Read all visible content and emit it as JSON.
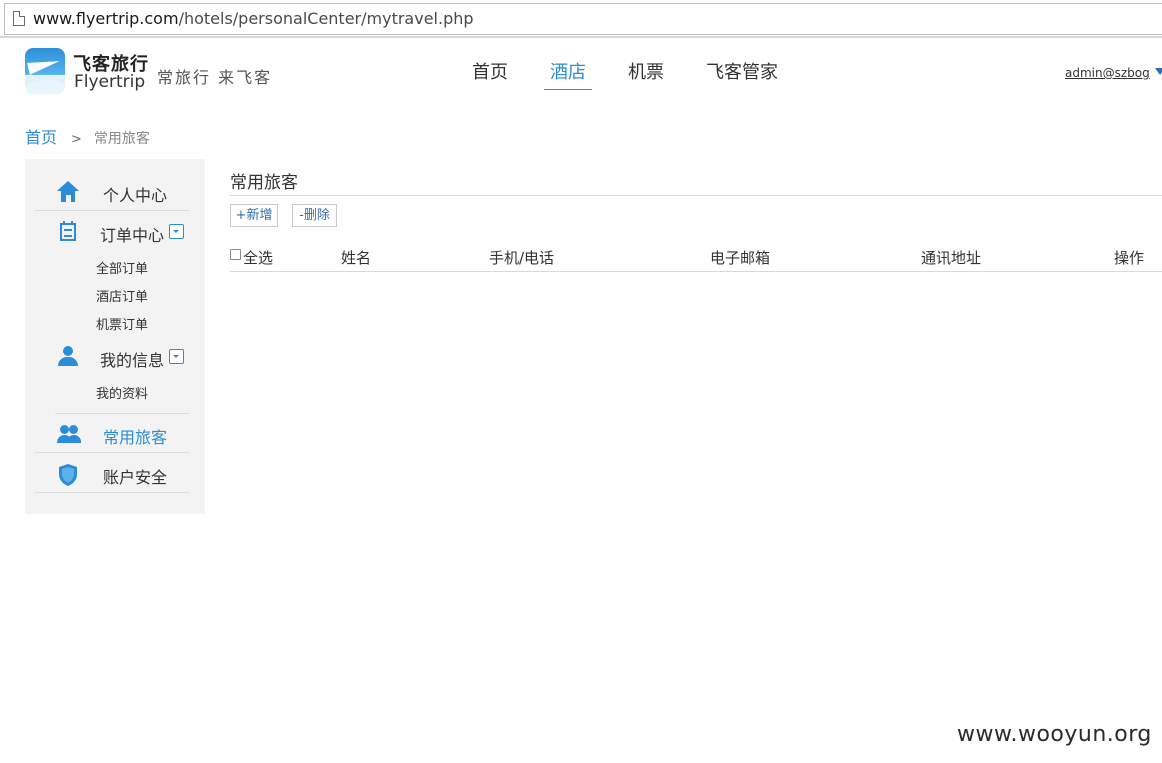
{
  "browser": {
    "url_host": "www.flyertrip.com",
    "url_path": "/hotels/personalCenter/mytravel.php"
  },
  "header": {
    "logo_cn": "飞客旅行",
    "logo_en": "Flyertrip",
    "slogan": "常旅行 来飞客",
    "nav": [
      {
        "label": "首页",
        "active": false
      },
      {
        "label": "酒店",
        "active": true
      },
      {
        "label": "机票",
        "active": false
      },
      {
        "label": "飞客管家",
        "active": false
      }
    ],
    "user": "admin@szbog"
  },
  "breadcrumb": {
    "home": "首页",
    "separator": ">",
    "current": "常用旅客"
  },
  "sidebar": {
    "personal_center": "个人中心",
    "order_center": "订单中心",
    "order_items": [
      "全部订单",
      "酒店订单",
      "机票订单"
    ],
    "my_info": "我的信息",
    "my_info_items": [
      "我的资料"
    ],
    "frequent_travelers": "常用旅客",
    "account_security": "账户安全"
  },
  "main": {
    "title": "常用旅客",
    "add_button": "+新增",
    "delete_button": "-删除",
    "columns": {
      "select_all": "全选",
      "name": "姓名",
      "phone": "手机/电话",
      "email": "电子邮箱",
      "address": "通讯地址",
      "actions": "操作"
    }
  },
  "watermark": "www.wooyun.org",
  "colors": {
    "accent": "#2b8dd8",
    "sidebar_bg": "#f3f3f3",
    "divider": "#d9d9d9"
  }
}
